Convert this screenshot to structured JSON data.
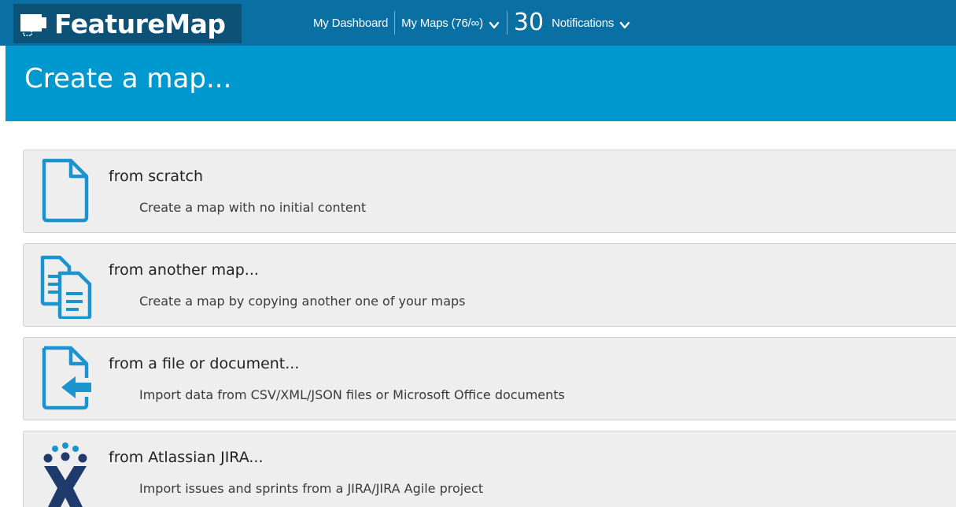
{
  "header": {
    "logo_text": "FeatureMap",
    "nav": {
      "dashboard": "My Dashboard",
      "maps": "My Maps (76/∞)",
      "notification_count": "30",
      "notifications": "Notifications"
    }
  },
  "page": {
    "title": "Create a map..."
  },
  "options": [
    {
      "icon": "blank-document-icon",
      "title": "from scratch",
      "description": "Create a map with no initial content"
    },
    {
      "icon": "copy-documents-icon",
      "title": "from another map...",
      "description": "Create a map by copying another one of your maps"
    },
    {
      "icon": "file-import-icon",
      "title": "from a file or document...",
      "description": "Import data from CSV/XML/JSON files or Microsoft Office documents"
    },
    {
      "icon": "jira-logo-icon",
      "title": "from Atlassian JIRA...",
      "description": "Import issues and sprints from a JIRA/JIRA Agile project"
    }
  ],
  "colors": {
    "topbar": "#0a6fa3",
    "logo_bg": "#0b5276",
    "title_band": "#0099cf",
    "icon_accent": "#1a93cf",
    "jira_navy": "#1f3b6b"
  }
}
